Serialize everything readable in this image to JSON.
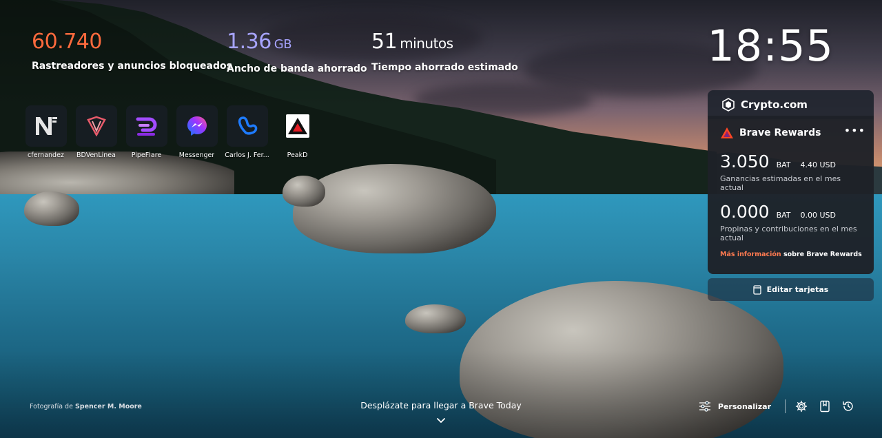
{
  "stats": {
    "trackers": {
      "value": "60.740",
      "label": "Rastreadores y anuncios bloqueados",
      "color": "#ff6a3d"
    },
    "bandwidth": {
      "value": "1.36",
      "unit": "GB",
      "label": "Ancho de banda ahorrado",
      "color": "#a7a4ff"
    },
    "time": {
      "value": "51",
      "unit": "minutos",
      "label": "Tiempo ahorrado estimado",
      "color": "#ffffff"
    }
  },
  "clock": "18:55",
  "top_sites": [
    {
      "label": "cfernandez",
      "icon": "n-logo-icon"
    },
    {
      "label": "BDVenLinea",
      "icon": "bdv-logo-icon"
    },
    {
      "label": "PipeFlare",
      "icon": "pipeflare-logo-icon"
    },
    {
      "label": "Messenger",
      "icon": "messenger-logo-icon"
    },
    {
      "label": "Carlos J. Fer...",
      "icon": "heart-logo-icon"
    },
    {
      "label": "PeakD",
      "icon": "peakd-logo-icon"
    }
  ],
  "widgets": {
    "crypto_tab": "Crypto.com",
    "rewards": {
      "title": "Brave Rewards",
      "more": "•••",
      "earnings_amount": "3.050",
      "earnings_unit": "BAT",
      "earnings_usd": "4.40 USD",
      "earnings_desc": "Ganancias estimadas en el mes actual",
      "tips_amount": "0.000",
      "tips_unit": "BAT",
      "tips_usd": "0.00 USD",
      "tips_desc": "Propinas y contribuciones en el mes actual",
      "info_link": "Más información",
      "info_rest": " sobre Brave Rewards"
    },
    "edit_cards": "Editar tarjetas"
  },
  "footer": {
    "photo_prefix": "Fotografía de ",
    "photo_author": "Spencer M. Moore",
    "scroll_hint": "Desplázate para llegar a Brave Today",
    "personalize": "Personalizar"
  },
  "colors": {
    "accent_orange": "#ff7a50",
    "bat_triangle": "#ff4724"
  }
}
